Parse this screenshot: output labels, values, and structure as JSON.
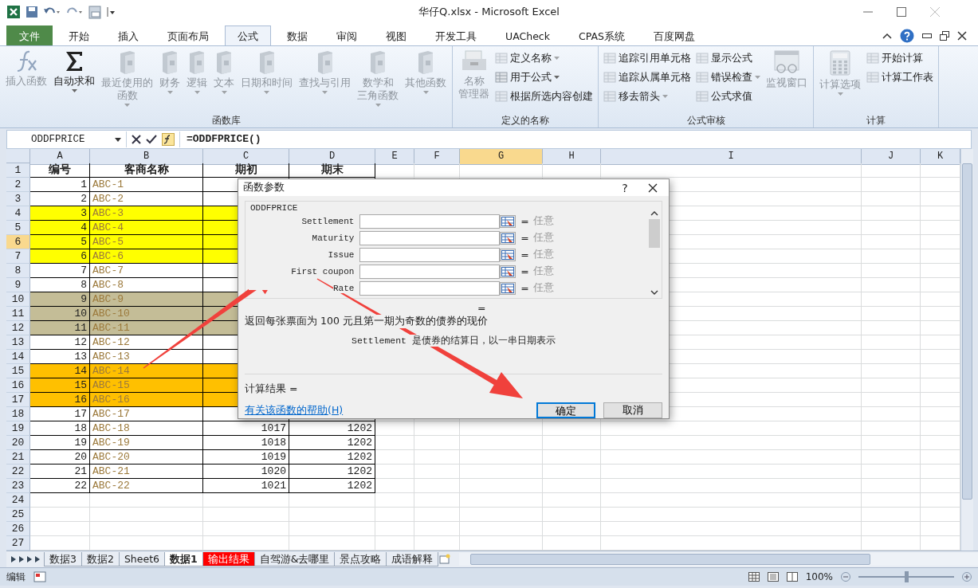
{
  "window": {
    "title": "华仔Q.xlsx  -  Microsoft Excel"
  },
  "ribbon_tabs": [
    {
      "label": "文件",
      "kind": "file",
      "selected": false
    },
    {
      "label": "开始",
      "kind": "tab",
      "selected": false
    },
    {
      "label": "插入",
      "kind": "tab",
      "selected": false
    },
    {
      "label": "页面布局",
      "kind": "tab",
      "selected": false
    },
    {
      "label": "公式",
      "kind": "tab",
      "selected": true
    },
    {
      "label": "数据",
      "kind": "tab",
      "selected": false
    },
    {
      "label": "审阅",
      "kind": "tab",
      "selected": false
    },
    {
      "label": "视图",
      "kind": "tab",
      "selected": false
    },
    {
      "label": "开发工具",
      "kind": "tab",
      "selected": false
    },
    {
      "label": "UACheck",
      "kind": "tab",
      "selected": false
    },
    {
      "label": "CPAS系统",
      "kind": "tab",
      "selected": false
    },
    {
      "label": "百度网盘",
      "kind": "tab",
      "selected": false
    }
  ],
  "ribbon_groups": [
    {
      "title": "函数库",
      "items": [
        {
          "kind": "large",
          "lines": [
            "插入函数"
          ],
          "disabled": true,
          "dropdown": false
        },
        {
          "kind": "large",
          "lines": [
            "自动求和"
          ],
          "disabled": false,
          "dropdown": true
        },
        {
          "kind": "large",
          "lines": [
            "最近使用的",
            "函数"
          ],
          "disabled": true,
          "dropdown": true
        },
        {
          "kind": "large",
          "lines": [
            "财务"
          ],
          "disabled": true,
          "dropdown": true
        },
        {
          "kind": "large",
          "lines": [
            "逻辑"
          ],
          "disabled": true,
          "dropdown": true
        },
        {
          "kind": "large",
          "lines": [
            "文本"
          ],
          "disabled": true,
          "dropdown": true
        },
        {
          "kind": "large",
          "lines": [
            "日期和时间"
          ],
          "disabled": true,
          "dropdown": true
        },
        {
          "kind": "large",
          "lines": [
            "查找与引用"
          ],
          "disabled": true,
          "dropdown": true
        },
        {
          "kind": "large",
          "lines": [
            "数学和",
            "三角函数"
          ],
          "disabled": true,
          "dropdown": true
        },
        {
          "kind": "large",
          "lines": [
            "其他函数"
          ],
          "disabled": true,
          "dropdown": true
        }
      ]
    },
    {
      "title": "定义的名称",
      "items": [
        {
          "kind": "large",
          "lines": [
            "名称",
            "管理器"
          ],
          "disabled": true,
          "dropdown": false
        },
        {
          "kind": "stack",
          "buttons": [
            {
              "label": "定义名称",
              "disabled": true,
              "dropdown": true
            },
            {
              "label": "用于公式",
              "disabled": false,
              "dropdown": true
            },
            {
              "label": "根据所选内容创建",
              "disabled": true,
              "dropdown": false
            }
          ]
        }
      ]
    },
    {
      "title": "公式审核",
      "items": [
        {
          "kind": "stack",
          "buttons": [
            {
              "label": "追踪引用单元格",
              "disabled": true,
              "dropdown": false
            },
            {
              "label": "追踪从属单元格",
              "disabled": true,
              "dropdown": false
            },
            {
              "label": "移去箭头",
              "disabled": true,
              "dropdown": true
            }
          ]
        },
        {
          "kind": "stack",
          "buttons": [
            {
              "label": "显示公式",
              "disabled": true,
              "dropdown": false
            },
            {
              "label": "错误检查",
              "disabled": true,
              "dropdown": true
            },
            {
              "label": "公式求值",
              "disabled": true,
              "dropdown": false
            }
          ]
        },
        {
          "kind": "large",
          "lines": [
            "监视窗口"
          ],
          "disabled": true,
          "dropdown": false
        }
      ]
    },
    {
      "title": "计算",
      "items": [
        {
          "kind": "large",
          "lines": [
            "计算选项"
          ],
          "disabled": true,
          "dropdown": true
        },
        {
          "kind": "stack",
          "buttons": [
            {
              "label": "开始计算",
              "disabled": true,
              "dropdown": false
            },
            {
              "label": "计算工作表",
              "disabled": true,
              "dropdown": false
            }
          ]
        }
      ]
    }
  ],
  "formula_bar": {
    "name_box": "ODDFPRICE",
    "formula": "=ODDFPRICE()"
  },
  "sheet": {
    "columns": [
      {
        "label": "A",
        "selected": false
      },
      {
        "label": "B",
        "selected": false
      },
      {
        "label": "C",
        "selected": false
      },
      {
        "label": "D",
        "selected": false
      },
      {
        "label": "E",
        "selected": false
      },
      {
        "label": "F",
        "selected": false
      },
      {
        "label": "G",
        "selected": true
      },
      {
        "label": "H",
        "selected": false
      },
      {
        "label": "I",
        "selected": false
      },
      {
        "label": "J",
        "selected": false
      },
      {
        "label": "K",
        "selected": false
      }
    ],
    "rows": [
      {
        "number": "1",
        "selected": false,
        "kind": "header",
        "cells": [
          "编号",
          "客商名称",
          "期初",
          "期末"
        ]
      },
      {
        "number": "2",
        "selected": false,
        "kind": "data",
        "cells": [
          "1",
          "ABC-1"
        ]
      },
      {
        "number": "3",
        "selected": false,
        "kind": "data",
        "cells": [
          "2",
          "ABC-2"
        ]
      },
      {
        "number": "4",
        "selected": false,
        "kind": "data",
        "color": "#ffff00",
        "cells": [
          "3",
          "ABC-3"
        ]
      },
      {
        "number": "5",
        "selected": false,
        "kind": "data",
        "color": "#ffff00",
        "cells": [
          "4",
          "ABC-4"
        ]
      },
      {
        "number": "6",
        "selected": true,
        "kind": "data",
        "color": "#ffff00",
        "cells": [
          "5",
          "ABC-5"
        ]
      },
      {
        "number": "7",
        "selected": false,
        "kind": "data",
        "color": "#ffff00",
        "cells": [
          "6",
          "ABC-6"
        ]
      },
      {
        "number": "8",
        "selected": false,
        "kind": "data",
        "cells": [
          "7",
          "ABC-7"
        ]
      },
      {
        "number": "9",
        "selected": false,
        "kind": "data",
        "cells": [
          "8",
          "ABC-8"
        ]
      },
      {
        "number": "10",
        "selected": false,
        "kind": "data",
        "color": "#c4bd97",
        "cells": [
          "9",
          "ABC-9"
        ]
      },
      {
        "number": "11",
        "selected": false,
        "kind": "data",
        "color": "#c4bd97",
        "cells": [
          "10",
          "ABC-10"
        ]
      },
      {
        "number": "12",
        "selected": false,
        "kind": "data",
        "color": "#c4bd97",
        "cells": [
          "11",
          "ABC-11"
        ]
      },
      {
        "number": "13",
        "selected": false,
        "kind": "data",
        "cells": [
          "12",
          "ABC-12"
        ]
      },
      {
        "number": "14",
        "selected": false,
        "kind": "data",
        "cells": [
          "13",
          "ABC-13"
        ]
      },
      {
        "number": "15",
        "selected": false,
        "kind": "data",
        "color": "#ffc000",
        "cells": [
          "14",
          "ABC-14"
        ]
      },
      {
        "number": "16",
        "selected": false,
        "kind": "data",
        "color": "#ffc000",
        "cells": [
          "15",
          "ABC-15"
        ]
      },
      {
        "number": "17",
        "selected": false,
        "kind": "data",
        "color": "#ffc000",
        "cells": [
          "16",
          "ABC-16"
        ]
      },
      {
        "number": "18",
        "selected": false,
        "kind": "data",
        "cells": [
          "17",
          "ABC-17"
        ]
      },
      {
        "number": "19",
        "selected": false,
        "kind": "data",
        "cells": [
          "18",
          "ABC-18",
          "1017",
          "1202"
        ]
      },
      {
        "number": "20",
        "selected": false,
        "kind": "data",
        "cells": [
          "19",
          "ABC-19",
          "1018",
          "1202"
        ]
      },
      {
        "number": "21",
        "selected": false,
        "kind": "data",
        "cells": [
          "20",
          "ABC-20",
          "1019",
          "1202"
        ]
      },
      {
        "number": "22",
        "selected": false,
        "kind": "data",
        "cells": [
          "21",
          "ABC-21",
          "1020",
          "1202"
        ]
      },
      {
        "number": "23",
        "selected": false,
        "kind": "data",
        "cells": [
          "22",
          "ABC-22",
          "1021",
          "1202"
        ]
      },
      {
        "number": "24",
        "selected": false,
        "kind": "empty"
      },
      {
        "number": "25",
        "selected": false,
        "kind": "empty"
      },
      {
        "number": "26",
        "selected": false,
        "kind": "empty"
      },
      {
        "number": "27",
        "selected": false,
        "kind": "empty"
      }
    ]
  },
  "dialog": {
    "title": "函数参数",
    "help": "?",
    "function_name": "ODDFPRICE",
    "args": [
      {
        "label": "Settlement",
        "sign": "=",
        "result": "任意"
      },
      {
        "label": "Maturity",
        "sign": "=",
        "result": "任意"
      },
      {
        "label": "Issue",
        "sign": "=",
        "result": "任意"
      },
      {
        "label": "First coupon",
        "sign": "=",
        "result": "任意"
      },
      {
        "label": "Rate",
        "sign": "=",
        "result": "任意"
      }
    ],
    "total_sign": "=",
    "description": "返回每张票面为 100 元且第一期为奇数的债券的现价",
    "arg_description": "Settlement  是债券的结算日，以一串日期表示",
    "result_label": "计算结果 =",
    "help_link": "有关该函数的帮助(H)",
    "buttons": [
      {
        "label": "确定",
        "selected": true
      },
      {
        "label": "取消",
        "selected": false
      }
    ]
  },
  "sheet_tabs": [
    {
      "label": "数据3",
      "selected": false
    },
    {
      "label": "数据2",
      "selected": false
    },
    {
      "label": "Sheet6",
      "selected": false
    },
    {
      "label": "数据1",
      "selected": true
    },
    {
      "label": "输出结果",
      "selected": false,
      "color": "#ff0000"
    },
    {
      "label": "自驾游&去哪里",
      "selected": false
    },
    {
      "label": "景点攻略",
      "selected": false
    },
    {
      "label": "成语解释",
      "selected": false
    }
  ],
  "status_bar": {
    "mode": "编辑",
    "zoom": "100%",
    "zoom_slider": {
      "level": 0.5
    }
  }
}
